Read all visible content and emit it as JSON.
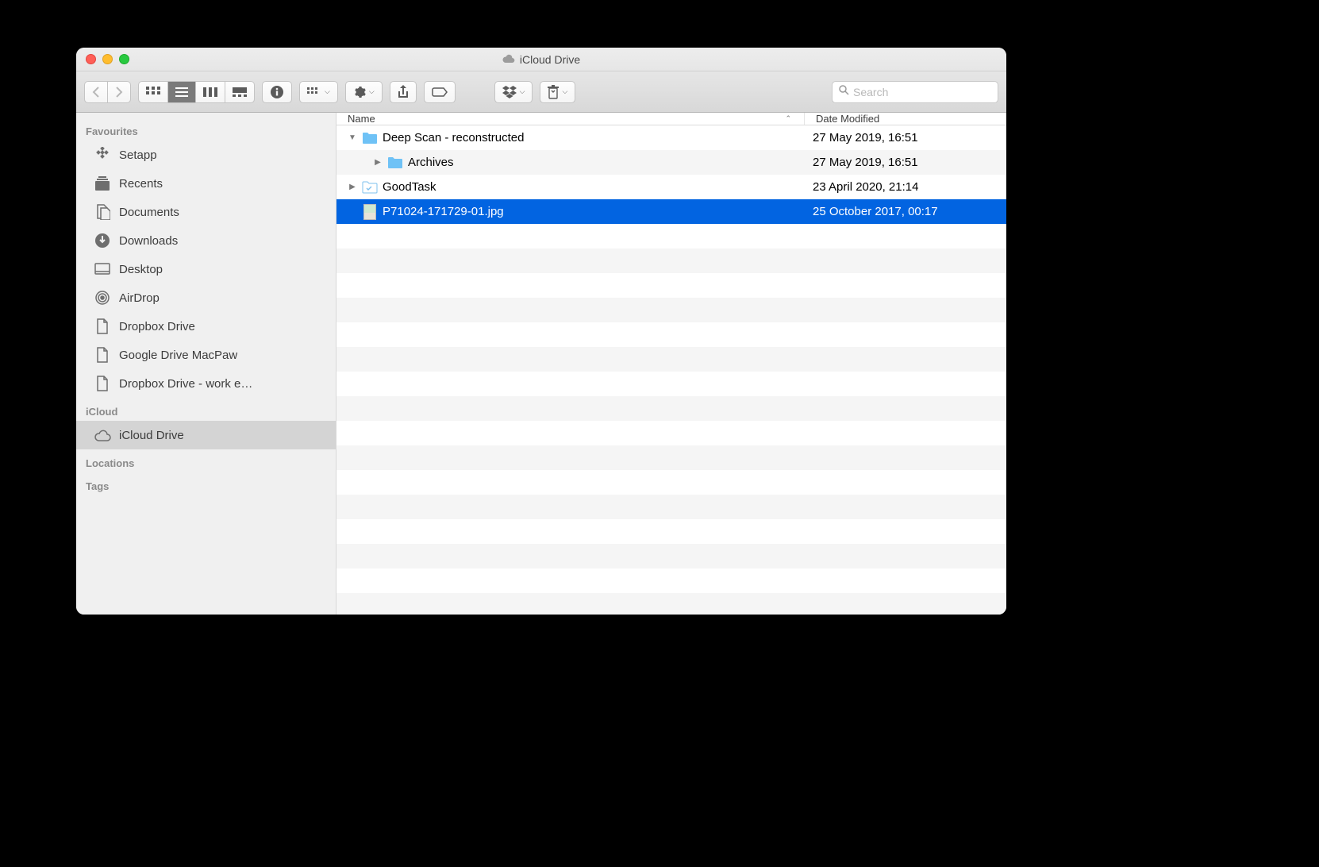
{
  "window": {
    "title": "iCloud Drive"
  },
  "toolbar": {
    "search_placeholder": "Search"
  },
  "columns": {
    "name": "Name",
    "date": "Date Modified"
  },
  "sidebar": {
    "sections": [
      {
        "title": "Favourites",
        "items": [
          {
            "label": "Setapp",
            "icon": "setapp"
          },
          {
            "label": "Recents",
            "icon": "recents"
          },
          {
            "label": "Documents",
            "icon": "documents"
          },
          {
            "label": "Downloads",
            "icon": "downloads"
          },
          {
            "label": "Desktop",
            "icon": "desktop"
          },
          {
            "label": "AirDrop",
            "icon": "airdrop"
          },
          {
            "label": "Dropbox Drive",
            "icon": "file"
          },
          {
            "label": "Google Drive MacPaw",
            "icon": "file"
          },
          {
            "label": "Dropbox Drive - work e…",
            "icon": "file"
          }
        ]
      },
      {
        "title": "iCloud",
        "items": [
          {
            "label": "iCloud Drive",
            "icon": "cloud",
            "selected": true
          }
        ]
      },
      {
        "title": "Locations",
        "items": []
      },
      {
        "title": "Tags",
        "items": []
      }
    ]
  },
  "files": [
    {
      "name": "Deep Scan - reconstructed",
      "date": "27 May 2019, 16:51",
      "type": "folder",
      "indent": 0,
      "expanded": true
    },
    {
      "name": "Archives",
      "date": "27 May 2019, 16:51",
      "type": "folder",
      "indent": 1,
      "expanded": false
    },
    {
      "name": "GoodTask",
      "date": "23 April 2020, 21:14",
      "type": "folder-task",
      "indent": 0,
      "expanded": false
    },
    {
      "name": "P71024-171729-01.jpg",
      "date": "25 October 2017, 00:17",
      "type": "image",
      "indent": 0,
      "selected": true
    }
  ]
}
